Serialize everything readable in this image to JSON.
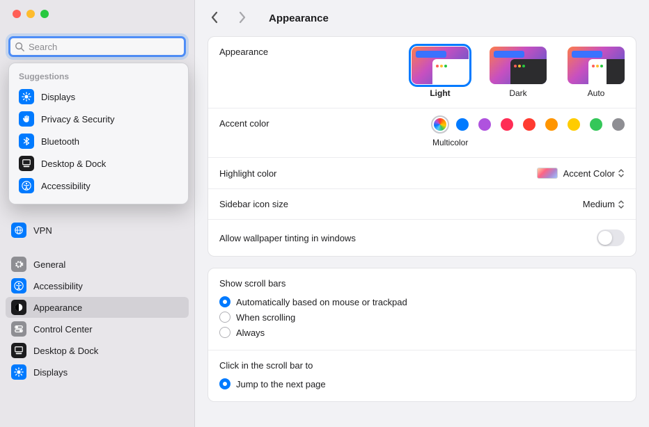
{
  "header": {
    "title": "Appearance"
  },
  "search": {
    "placeholder": "Search"
  },
  "suggestions": {
    "header": "Suggestions",
    "items": [
      {
        "label": "Displays",
        "icon": "sun-icon",
        "color": "blue"
      },
      {
        "label": "Privacy & Security",
        "icon": "hand-icon",
        "color": "blue"
      },
      {
        "label": "Bluetooth",
        "icon": "bluetooth-icon",
        "color": "blue"
      },
      {
        "label": "Desktop & Dock",
        "icon": "dock-icon",
        "color": "dark"
      },
      {
        "label": "Accessibility",
        "icon": "accessibility-icon",
        "color": "blue"
      }
    ]
  },
  "sidebar": {
    "items": [
      {
        "label": "VPN",
        "icon": "globe-icon",
        "color": "blue",
        "selected": false
      },
      {
        "gap": true
      },
      {
        "label": "General",
        "icon": "gear-icon",
        "color": "gray",
        "selected": false
      },
      {
        "label": "Accessibility",
        "icon": "accessibility-icon",
        "color": "blue",
        "selected": false
      },
      {
        "label": "Appearance",
        "icon": "appearance-icon",
        "color": "dark",
        "selected": true
      },
      {
        "label": "Control Center",
        "icon": "switches-icon",
        "color": "gray",
        "selected": false
      },
      {
        "label": "Desktop & Dock",
        "icon": "dock-icon",
        "color": "dark",
        "selected": false
      },
      {
        "label": "Displays",
        "icon": "sun-icon",
        "color": "blue",
        "selected": false
      }
    ]
  },
  "appearance": {
    "label": "Appearance",
    "options": [
      {
        "label": "Light",
        "selected": true
      },
      {
        "label": "Dark",
        "selected": false
      },
      {
        "label": "Auto",
        "selected": false
      }
    ]
  },
  "accent": {
    "label": "Accent color",
    "selected_label": "Multicolor",
    "colors": [
      {
        "name": "Multicolor",
        "css_class": "multicolor",
        "selected": true
      },
      {
        "name": "Blue",
        "hex": "#007aff"
      },
      {
        "name": "Purple",
        "hex": "#af52de"
      },
      {
        "name": "Pink",
        "hex": "#ff2d55"
      },
      {
        "name": "Red",
        "hex": "#ff3b30"
      },
      {
        "name": "Orange",
        "hex": "#ff9500"
      },
      {
        "name": "Yellow",
        "hex": "#ffcc00"
      },
      {
        "name": "Green",
        "hex": "#34c759"
      },
      {
        "name": "Graphite",
        "hex": "#8e8e93"
      }
    ]
  },
  "highlight": {
    "label": "Highlight color",
    "value": "Accent Color"
  },
  "sidebar_icon": {
    "label": "Sidebar icon size",
    "value": "Medium"
  },
  "tinting": {
    "label": "Allow wallpaper tinting in windows",
    "value": false
  },
  "scrollbars": {
    "label": "Show scroll bars",
    "options": [
      {
        "label": "Automatically based on mouse or trackpad",
        "checked": true
      },
      {
        "label": "When scrolling",
        "checked": false
      },
      {
        "label": "Always",
        "checked": false
      }
    ]
  },
  "click_scroll": {
    "label": "Click in the scroll bar to",
    "options": [
      {
        "label": "Jump to the next page",
        "checked": true
      }
    ]
  }
}
